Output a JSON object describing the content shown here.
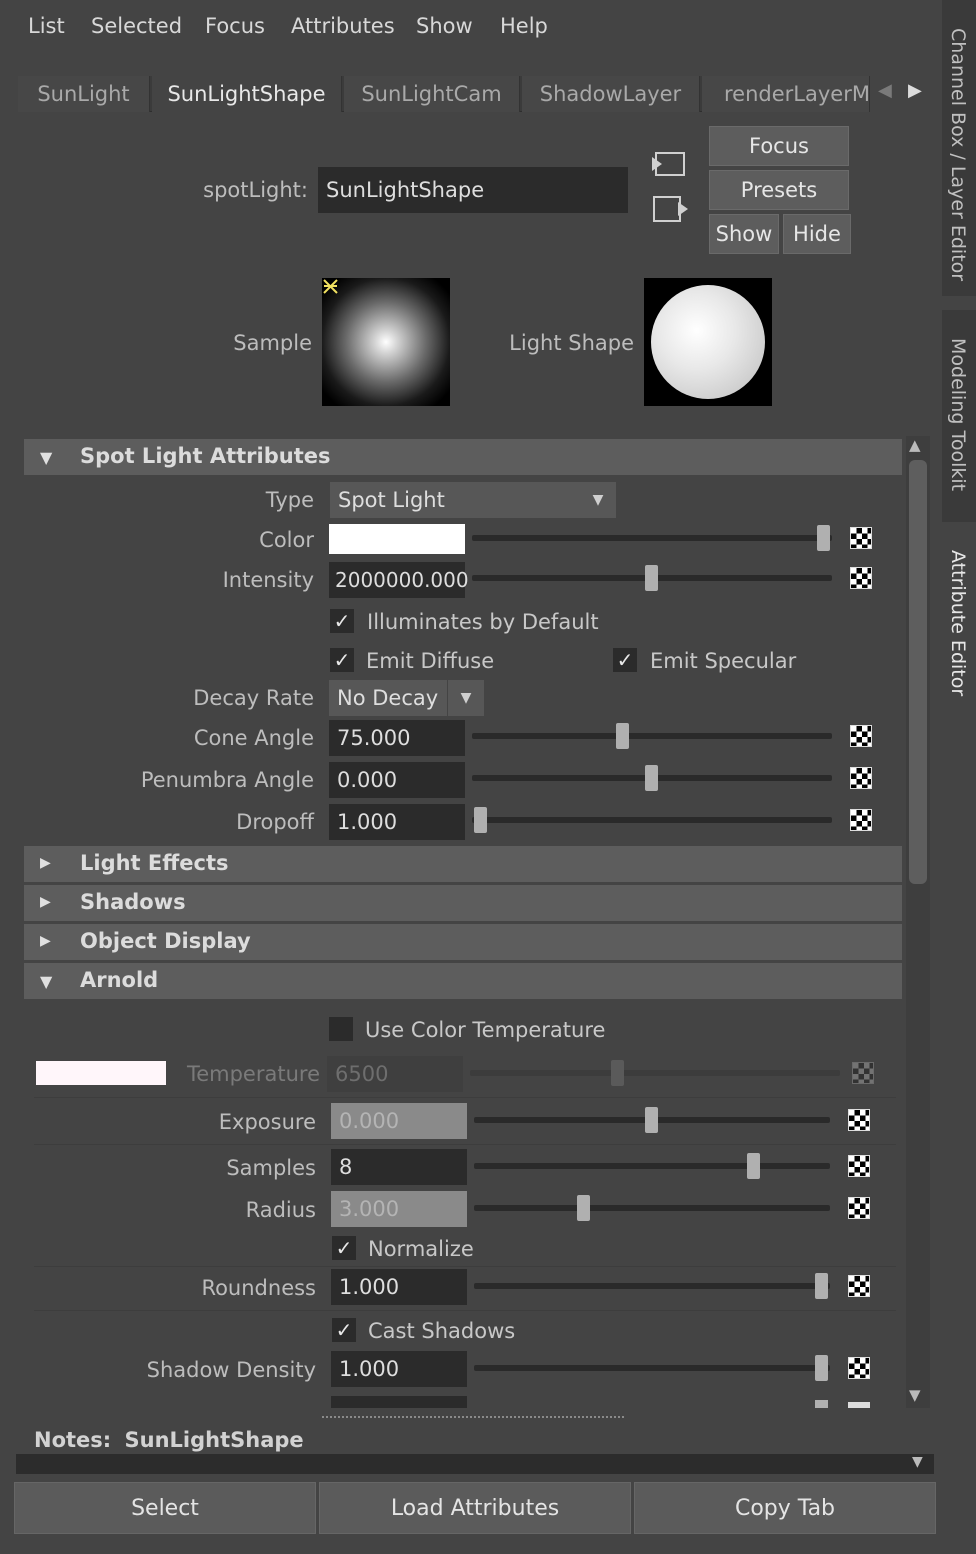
{
  "menu": [
    "List",
    "Selected",
    "Focus",
    "Attributes",
    "Show",
    "Help"
  ],
  "tabs": [
    "SunLight",
    "SunLightShape",
    "SunLightCam",
    "ShadowLayer",
    "renderLayerMa"
  ],
  "node": {
    "type_label": "spotLight:",
    "name": "SunLightShape"
  },
  "buttons": {
    "focus": "Focus",
    "presets": "Presets",
    "show": "Show",
    "hide": "Hide"
  },
  "swatches": {
    "sample_label": "Sample",
    "light_shape_label": "Light Shape"
  },
  "side_tabs": [
    "Channel Box / Layer Editor",
    "Modeling Toolkit",
    "Attribute Editor"
  ],
  "spot_light": {
    "title": "Spot Light Attributes",
    "type_label": "Type",
    "type_value": "Spot Light",
    "color_label": "Color",
    "color_value": "#ffffff",
    "intensity_label": "Intensity",
    "intensity_value": "2000000.000",
    "illuminates_default": "Illuminates by Default",
    "emit_diffuse": "Emit Diffuse",
    "emit_specular": "Emit Specular",
    "decay_label": "Decay Rate",
    "decay_value": "No Decay",
    "cone_label": "Cone Angle",
    "cone_value": "75.000",
    "penumbra_label": "Penumbra Angle",
    "penumbra_value": "0.000",
    "dropoff_label": "Dropoff",
    "dropoff_value": "1.000"
  },
  "collapsed_sections": [
    "Light Effects",
    "Shadows",
    "Object Display"
  ],
  "arnold": {
    "title": "Arnold",
    "use_color_temp": "Use Color Temperature",
    "temperature_label": "Temperature",
    "temperature_value": "6500",
    "exposure_label": "Exposure",
    "exposure_value": "0.000",
    "samples_label": "Samples",
    "samples_value": "8",
    "radius_label": "Radius",
    "radius_value": "3.000",
    "normalize": "Normalize",
    "roundness_label": "Roundness",
    "roundness_value": "1.000",
    "cast_shadows": "Cast Shadows",
    "shadow_density_label": "Shadow Density",
    "shadow_density_value": "1.000"
  },
  "notes": {
    "label": "Notes:",
    "name": "SunLightShape"
  },
  "footer": {
    "select": "Select",
    "load": "Load Attributes",
    "copy": "Copy Tab"
  },
  "check_glyph": "✓",
  "icons": {
    "expanded": "▼",
    "collapsed": "▶",
    "dropdown": "▼",
    "tab_left": "◀",
    "tab_right": "▶",
    "scroll_up": "▲",
    "scroll_down": "▼"
  }
}
